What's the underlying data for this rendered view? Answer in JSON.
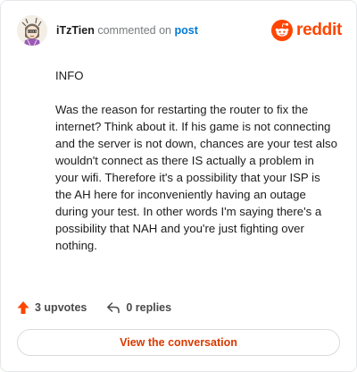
{
  "header": {
    "username": "iTzTien",
    "verb": "commented on",
    "post_link": "post"
  },
  "brand": {
    "wordmark": "reddit",
    "accent_color": "#ff4500"
  },
  "comment": {
    "paragraphs": [
      "INFO",
      "Was the reason for restarting the router to fix the internet? Think about it. If his game is not connecting and the server is not down, chances are your test also wouldn't connect as there IS actually a problem in your wifi. Therefore it's a possibility that your ISP is the AH here for inconveniently having an outage during your test. In other words I'm saying there's a possibility that NAH and you're just fighting over nothing."
    ]
  },
  "actions": {
    "upvotes_label": "3 upvotes",
    "replies_label": "0 replies",
    "upvote_icon": "upvote-arrow-icon",
    "reply_icon": "reply-arrow-icon"
  },
  "cta": {
    "label": "View the conversation",
    "color": "#d93a00"
  }
}
